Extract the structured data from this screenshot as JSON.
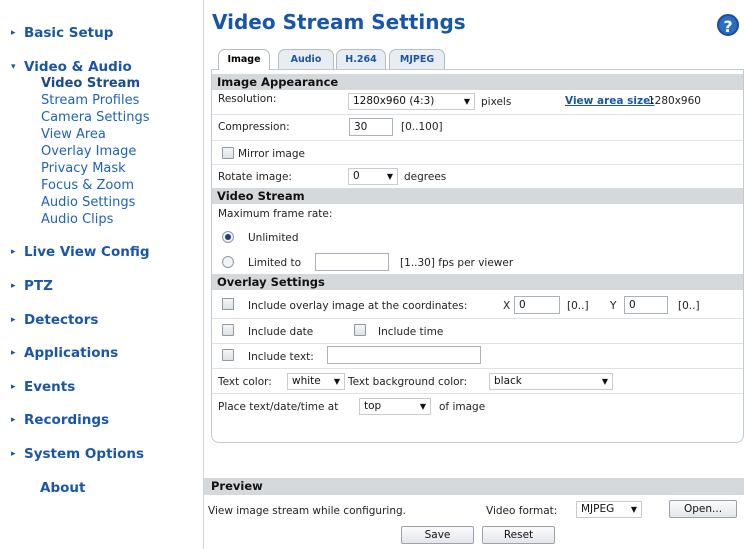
{
  "sidebar": {
    "basic_setup": "Basic Setup",
    "video_audio": "Video & Audio",
    "video_audio_items": [
      "Video Stream",
      "Stream Profiles",
      "Camera Settings",
      "View Area",
      "Overlay Image",
      "Privacy Mask",
      "Focus & Zoom",
      "Audio Settings",
      "Audio Clips"
    ],
    "live_view_config": "Live View Config",
    "ptz": "PTZ",
    "detectors": "Detectors",
    "applications": "Applications",
    "events": "Events",
    "recordings": "Recordings",
    "system_options": "System Options",
    "about": "About",
    "collapsed_arrow": "▸",
    "expanded_arrow": "▾"
  },
  "header": {
    "title": "Video Stream Settings",
    "help": "?"
  },
  "tabs": [
    "Image",
    "Audio",
    "H.264",
    "MJPEG"
  ],
  "image_appearance": {
    "title": "Image Appearance",
    "resolution_label": "Resolution:",
    "resolution_value": "1280x960 (4:3)",
    "resolution_unit": "pixels",
    "view_area_link": "View area size:",
    "view_area_value": "1280x960",
    "compression_label": "Compression:",
    "compression_value": "30",
    "compression_range": "[0..100]",
    "mirror_label": "Mirror image",
    "rotate_label": "Rotate image:",
    "rotate_value": "0",
    "rotate_unit": "degrees"
  },
  "video_stream": {
    "title": "Video Stream",
    "max_frame_rate_label": "Maximum frame rate:",
    "unlimited_label": "Unlimited",
    "limited_label": "Limited to",
    "limited_value": "",
    "limited_range": "[1..30] fps per viewer"
  },
  "overlay_settings": {
    "title": "Overlay Settings",
    "include_overlay_label": "Include overlay image at the coordinates:",
    "x_label": "X",
    "x_value": "0",
    "x_range": "[0..]",
    "y_label": "Y",
    "y_value": "0",
    "y_range": "[0..]",
    "include_date_label": "Include date",
    "include_time_label": "Include time",
    "include_text_label": "Include text:",
    "include_text_value": "",
    "text_color_label": "Text color:",
    "text_color_value": "white",
    "text_bg_label": "Text background color:",
    "text_bg_value": "black",
    "place_label": "Place text/date/time at",
    "place_value": "top",
    "place_suffix": "of image"
  },
  "preview": {
    "title": "Preview",
    "description": "View image stream while configuring.",
    "format_label": "Video format:",
    "format_value": "MJPEG",
    "open_button": "Open..."
  },
  "actions": {
    "save": "Save",
    "reset": "Reset"
  },
  "colors": {
    "accent": "#1a56a8",
    "section_bg": "#d6d9dc"
  }
}
